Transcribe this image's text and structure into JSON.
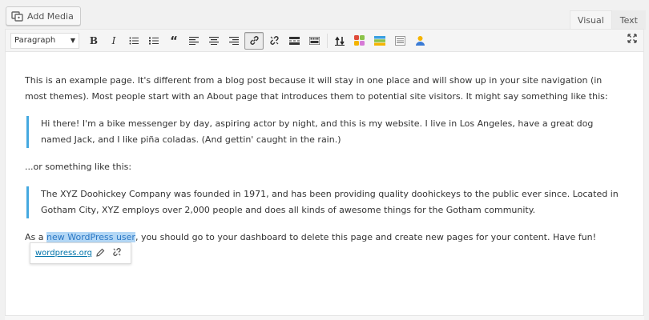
{
  "add_media": {
    "label": "Add Media",
    "icon": "media-icon"
  },
  "tabs": {
    "visual": "Visual",
    "text": "Text"
  },
  "toolbar": {
    "format_select": "Paragraph",
    "buttons": [
      "bold",
      "italic",
      "bulleted-list",
      "numbered-list",
      "blockquote",
      "align-left",
      "align-center",
      "align-right",
      "insert-link",
      "remove-link",
      "read-more",
      "toolbar-toggle",
      "insert-after",
      "color-grid",
      "layout",
      "page-break",
      "user"
    ],
    "bold_glyph": "B",
    "italic_glyph": "I"
  },
  "content": {
    "p1": "This is an example page. It's different from a blog post because it will stay in one place and will show up in your site navigation (in most themes). Most people start with an About page that introduces them to potential site visitors. It might say something like this:",
    "quote1": "Hi there! I'm a bike messenger by day, aspiring actor by night, and this is my website. I live in Los Angeles, have a great dog named Jack, and I like piña coladas. (And gettin' caught in the rain.)",
    "p2": "...or something like this:",
    "quote2": "The XYZ Doohickey Company was founded in 1971, and has been providing quality doohickeys to the public ever since. Located in Gotham City, XYZ employs over 2,000 people and does all kinds of awesome things for the Gotham community.",
    "p3_before": "As a ",
    "p3_link": "new WordPress user",
    "p3_after": ", you should go to your dashboard to delete this page and create new pages for your content. Have fun!"
  },
  "link_tooltip": {
    "url": "wordpress.org"
  },
  "colors": {
    "accent": "#45a9e0",
    "selection": "#b3d7f5",
    "link": "#0073aa"
  }
}
